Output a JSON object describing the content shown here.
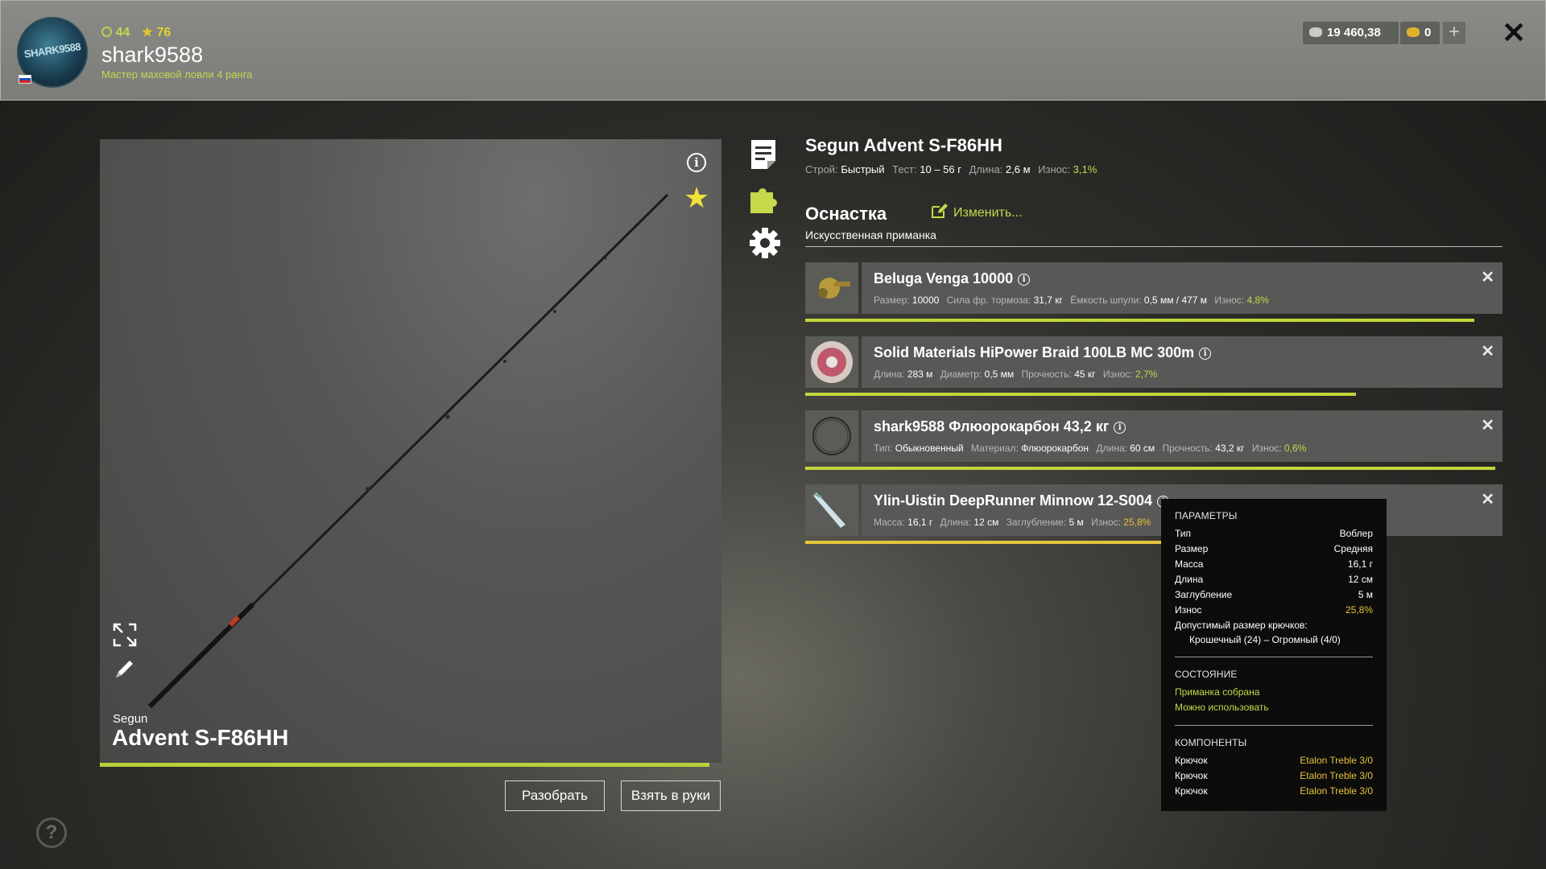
{
  "header": {
    "avatar_text": "SHARK9588",
    "level": "44",
    "rank_level": "76",
    "username": "shark9588",
    "rank_title": "Мастер маховой ловли 4 ранга",
    "silver": "19 460,38",
    "gold": "0",
    "add_icon": "plus-icon",
    "close_icon": "close-icon"
  },
  "rod": {
    "brand": "Segun",
    "model": "Advent S-F86HH",
    "wear_fraction": 0.98
  },
  "buttons": {
    "disassemble": "Разобрать",
    "take": "Взять в руки"
  },
  "details": {
    "title": "Segun Advent S-F86HH",
    "stats": [
      {
        "k": "Строй:",
        "v": "Быстрый"
      },
      {
        "k": "Тест:",
        "v": "10 – 56 г"
      },
      {
        "k": "Длина:",
        "v": "2,6 м"
      },
      {
        "k": "Износ:",
        "v": "3,1%",
        "green": true
      }
    ],
    "section": "Оснастка",
    "edit": "Изменить...",
    "subtype": "Искусственная приманка"
  },
  "tackle": [
    {
      "name": "Beluga Venga 10000",
      "stats": [
        {
          "k": "Размер:",
          "v": "10000"
        },
        {
          "k": "Сила фр. тормоза:",
          "v": "31,7 кг"
        },
        {
          "k": "Ёмкость шпули:",
          "v": "0,5 мм / 477 м"
        },
        {
          "k": "Износ:",
          "v": "4,8%",
          "green": true
        }
      ],
      "wear_fraction": 0.96,
      "bar_color": "#c2d53d"
    },
    {
      "name": "Solid Materials HiPower Braid 100LB MC 300m",
      "stats": [
        {
          "k": "Длина:",
          "v": "283 м"
        },
        {
          "k": "Диаметр:",
          "v": "0,5 мм"
        },
        {
          "k": "Прочность:",
          "v": "45 кг"
        },
        {
          "k": "Износ:",
          "v": "2,7%",
          "green": true
        }
      ],
      "wear_fraction": 0.79,
      "bar_color": "#c2d53d"
    },
    {
      "name": "shark9588 Флюорокарбон 43,2 кг",
      "stats": [
        {
          "k": "Тип:",
          "v": "Обыкновенный"
        },
        {
          "k": "Материал:",
          "v": "Флюорокарбон"
        },
        {
          "k": "Длина:",
          "v": "60 см"
        },
        {
          "k": "Прочность:",
          "v": "43,2 кг"
        },
        {
          "k": "Износ:",
          "v": "0,6%",
          "green": true
        }
      ],
      "wear_fraction": 0.99,
      "bar_color": "#c2d53d"
    },
    {
      "name": "Ylin-Uistin DeepRunner Minnow 12-S004",
      "stats": [
        {
          "k": "Масса:",
          "v": "16,1 г"
        },
        {
          "k": "Длина:",
          "v": "12 см"
        },
        {
          "k": "Заглубление:",
          "v": "5 м"
        },
        {
          "k": "Износ:",
          "v": "25,8%",
          "yellow": true
        }
      ],
      "wear_fraction": 0.74,
      "bar_color": "#e5c53a"
    }
  ],
  "tooltip": {
    "params_header": "ПАРАМЕТРЫ",
    "params": [
      {
        "k": "Тип",
        "v": "Воблер"
      },
      {
        "k": "Размер",
        "v": "Средняя"
      },
      {
        "k": "Масса",
        "v": "16,1 г"
      },
      {
        "k": "Длина",
        "v": "12 см"
      },
      {
        "k": "Заглубление",
        "v": "5 м"
      },
      {
        "k": "Износ",
        "v": "25,8%"
      }
    ],
    "hook_label": "Допустимый размер крючков:",
    "hook_range": "Крошечный (24) – Огромный (4/0)",
    "state_header": "СОСТОЯНИЕ",
    "state": [
      "Приманка собрана",
      "Можно использовать"
    ],
    "components_header": "КОМПОНЕНТЫ",
    "components": [
      {
        "k": "Крючок",
        "v": "Etalon Treble 3/0"
      },
      {
        "k": "Крючок",
        "v": "Etalon Treble 3/0"
      },
      {
        "k": "Крючок",
        "v": "Etalon Treble 3/0"
      }
    ]
  },
  "help": "?",
  "colors": {
    "accent_green": "#c5d94a",
    "accent_yellow": "#e8c33a",
    "favorite_star": "#f1e13a"
  }
}
